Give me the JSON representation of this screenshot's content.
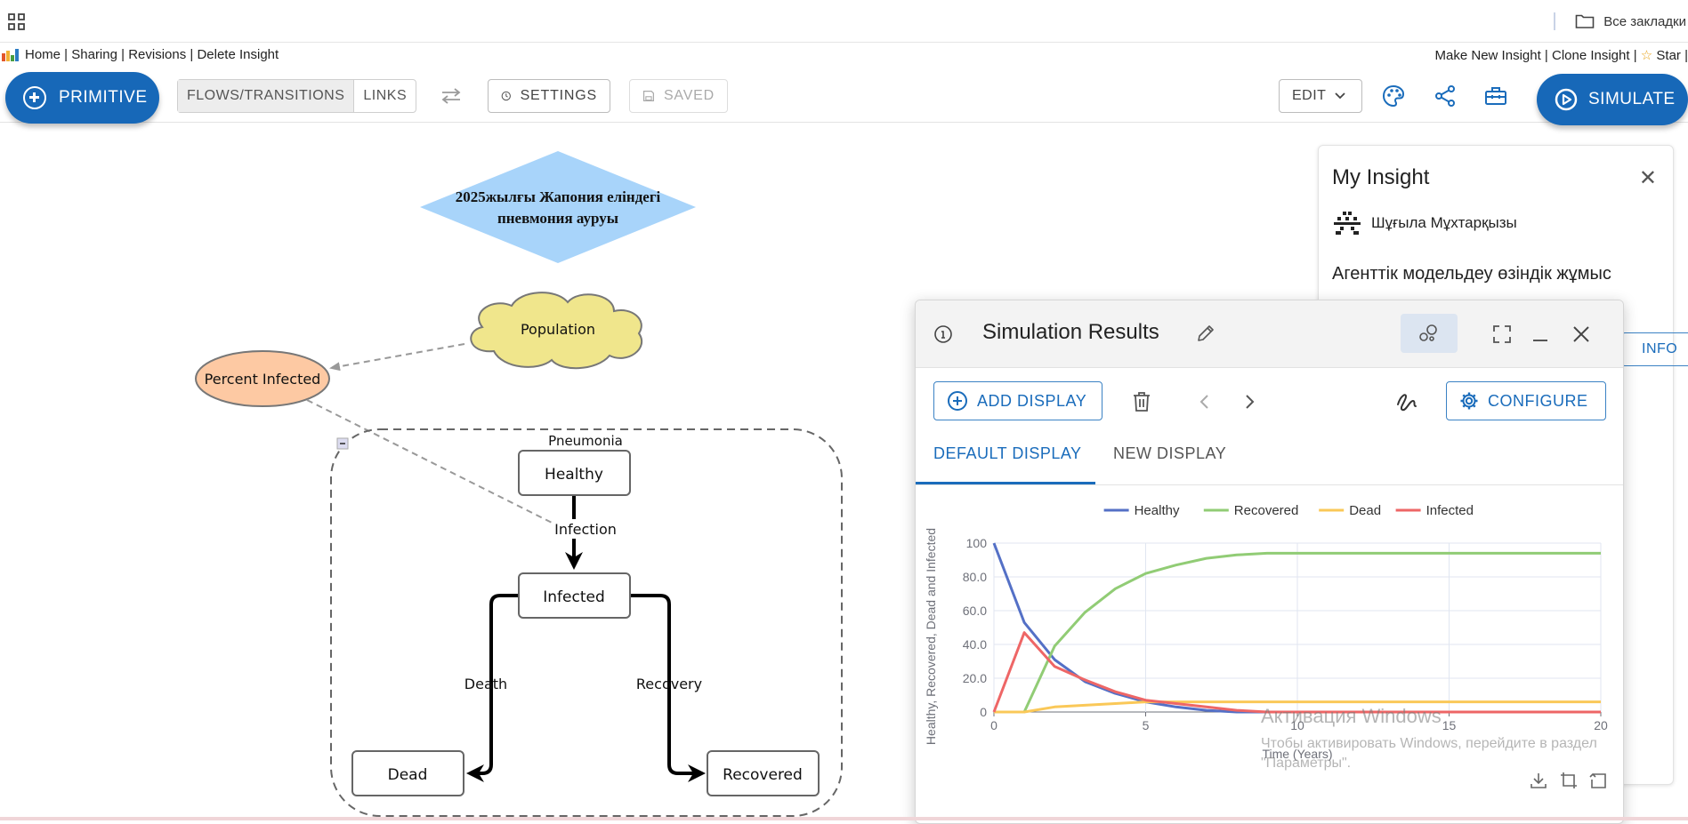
{
  "browser": {
    "all_bookmarks": "Все закладки"
  },
  "links": {
    "left": [
      "Home",
      "Sharing",
      "Revisions",
      "Delete Insight"
    ],
    "right": [
      "Make New Insight",
      "Clone Insight",
      "Star"
    ]
  },
  "toolbar": {
    "primitive_label": "PRIMITIVE",
    "flows_label": "FLOWS/TRANSITIONS",
    "links_label": "LINKS",
    "settings_label": "SETTINGS",
    "saved_label": "SAVED",
    "edit_label": "EDIT",
    "simulate_label": "SIMULATE"
  },
  "diagram": {
    "title_line1": "2025жылғы Жапония еліндегі",
    "title_line2": "пневмония ауруы",
    "population": "Population",
    "percent_infected": "Percent Infected",
    "folder_label": "Pneumonia",
    "healthy": "Healthy",
    "infection": "Infection",
    "infected": "Infected",
    "death": "Death",
    "recovery": "Recovery",
    "dead": "Dead",
    "recovered": "Recovered"
  },
  "insight": {
    "title": "My Insight",
    "author": "Шұғыла Мұхтарқызы",
    "description": "Агенттік модельдеу өзіндік жұмыс",
    "info_label": "INFO"
  },
  "simulation": {
    "title": "Simulation Results",
    "add_display": "ADD DISPLAY",
    "configure": "CONFIGURE",
    "tabs": [
      "DEFAULT DISPLAY",
      "NEW DISPLAY"
    ],
    "active_tab": 0
  },
  "chart_data": {
    "type": "line",
    "xlabel": "Time (Years)",
    "ylabel": "Healthy, Recovered, Dead and Infected",
    "xlim": [
      0,
      20
    ],
    "ylim": [
      0,
      100
    ],
    "xticks": [
      "0",
      "5",
      "10",
      "15",
      "20"
    ],
    "yticks": [
      "0",
      "20.0",
      "40.0",
      "60.0",
      "80.0",
      "100"
    ],
    "x": [
      0,
      1,
      2,
      3,
      4,
      5,
      6,
      7,
      8,
      9,
      10,
      11,
      12,
      13,
      14,
      15,
      16,
      17,
      18,
      19,
      20
    ],
    "legend_position": "top",
    "series": [
      {
        "name": "Healthy",
        "color": "#5470c6",
        "values": [
          100,
          53,
          31,
          18,
          11,
          6,
          3,
          1,
          0,
          0,
          0,
          0,
          0,
          0,
          0,
          0,
          0,
          0,
          0,
          0,
          0
        ]
      },
      {
        "name": "Recovered",
        "color": "#91cc75",
        "values": [
          0,
          0,
          39,
          59,
          73,
          82,
          87,
          91,
          93,
          94,
          94,
          94,
          94,
          94,
          94,
          94,
          94,
          94,
          94,
          94,
          94
        ]
      },
      {
        "name": "Dead",
        "color": "#fac858",
        "values": [
          0,
          0,
          3,
          4,
          5,
          6,
          6,
          6,
          6,
          6,
          6,
          6,
          6,
          6,
          6,
          6,
          6,
          6,
          6,
          6,
          6
        ]
      },
      {
        "name": "Infected",
        "color": "#ee6666",
        "values": [
          0,
          47,
          27,
          19,
          12,
          7,
          5,
          3,
          1,
          0,
          0,
          0,
          0,
          0,
          0,
          0,
          0,
          0,
          0,
          0,
          0
        ]
      }
    ]
  },
  "os": {
    "watermark_title": "Активация Windows",
    "watermark_line1": "Чтобы активировать Windows, перейдите в раздел",
    "watermark_line2": "\"Параметры\"."
  }
}
